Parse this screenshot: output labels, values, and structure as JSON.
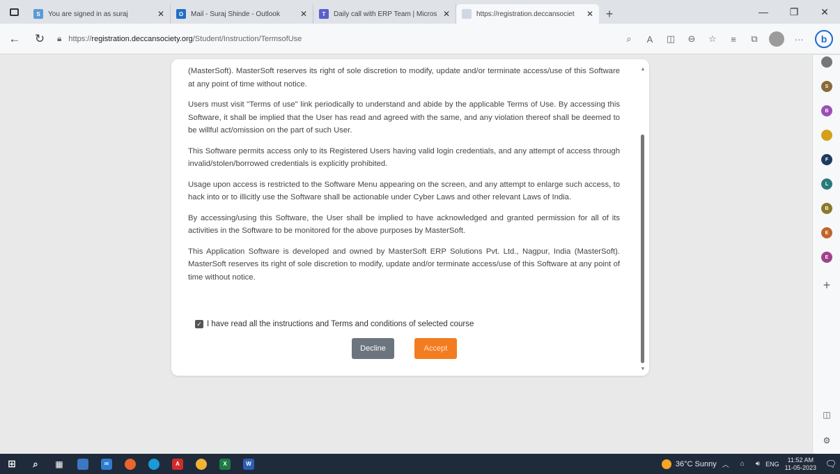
{
  "browser": {
    "tabs": [
      {
        "label": "You are signed in as suraj",
        "favicon_color": "#5a9bd5",
        "favicon_text": "S",
        "active": false
      },
      {
        "label": "Mail - Suraj Shinde - Outlook",
        "favicon_color": "#1f6fc5",
        "favicon_text": "O",
        "active": false
      },
      {
        "label": "Daily call with ERP Team | Micros",
        "favicon_color": "#5b5fc7",
        "favicon_text": "T",
        "active": false
      },
      {
        "label": "https://registration.deccansociet",
        "favicon_color": "#d0d8e4",
        "favicon_text": "",
        "active": true
      }
    ],
    "url_prefix": "https://",
    "url_host": "registration.deccansociety.org",
    "url_path": "/Student/Instruction/TermsofUse"
  },
  "dialog": {
    "paragraphs": [
      "(MasterSoft). MasterSoft reserves its right of sole discretion to modify, update and/or terminate access/use of this Software at any point of time without notice.",
      "Users must visit \"Terms of use\" link periodically to understand and abide by the applicable Terms of Use. By accessing this Software, it shall be implied that the User has read and agreed with the same, and any violation thereof shall be deemed to be willful act/omission on the part of such User.",
      "This Software permits access only to its Registered Users having valid login credentials, and any attempt of access through invalid/stolen/borrowed credentials is explicitly prohibited.",
      "Usage upon access is restricted to the Software Menu appearing on the screen, and any attempt to enlarge such access, to hack into or to illicitly use the Software shall be actionable under Cyber Laws and other relevant Laws of India.",
      "By accessing/using this Software, the User shall be implied to have acknowledged and granted permission for all of its activities in the Software to be monitored for the above purposes by MasterSoft.",
      "This Application Software is developed and owned by MasterSoft ERP Solutions Pvt. Ltd., Nagpur, India (MasterSoft). MasterSoft reserves its right of sole discretion to modify, update and/or terminate access/use of this Software at any point of time without notice."
    ],
    "agree_label": "I have read all the instructions and Terms and conditions of selected course",
    "agree_checked": true,
    "decline_label": "Decline",
    "accept_label": "Accept"
  },
  "sidebar": {
    "items": [
      {
        "name": "sidebar-app-gray",
        "color": "#777777",
        "text": ""
      },
      {
        "name": "sidebar-app-brown",
        "color": "#8a6a3a",
        "text": "S"
      },
      {
        "name": "sidebar-app-purple",
        "color": "#9b4fb5",
        "text": "B"
      },
      {
        "name": "sidebar-app-people",
        "color": "#d4a017",
        "text": ""
      },
      {
        "name": "sidebar-app-navy",
        "color": "#1e3a5f",
        "text": "F"
      },
      {
        "name": "sidebar-app-teal",
        "color": "#2a7a7a",
        "text": "L"
      },
      {
        "name": "sidebar-app-olive",
        "color": "#8a7a2a",
        "text": "B"
      },
      {
        "name": "sidebar-app-orange",
        "color": "#c2642a",
        "text": "E"
      },
      {
        "name": "sidebar-app-magenta",
        "color": "#a0428a",
        "text": "E"
      }
    ]
  },
  "taskbar": {
    "weather": "36°C Sunny",
    "lang": "ENG",
    "time": "11:52 AM",
    "date": "11-05-2023"
  }
}
